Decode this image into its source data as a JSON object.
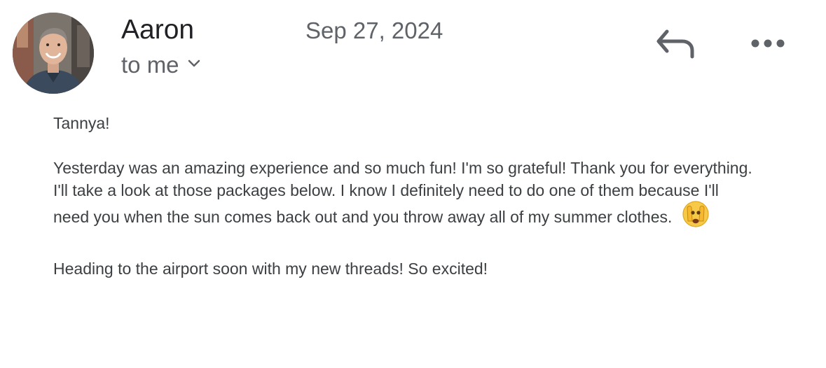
{
  "message": {
    "sender_name": "Aaron",
    "date": "Sep 27, 2024",
    "recipient_label": "to me",
    "greeting": "Tannya!",
    "paragraph1": "Yesterday was an amazing experience and so much fun! I'm so grateful! Thank you for everything. I'll take a look at those packages below. I know I definitely need to do one of them because I'll need you when the sun comes back out and you throw away all of my summer clothes.",
    "paragraph2": "Heading to the airport soon with my new threads! So excited!"
  },
  "icons": {
    "avatar": "avatar-photo",
    "recipient_toggle": "chevron-down-icon",
    "reply": "reply-icon",
    "more": "more-horizontal-icon",
    "emoji": "face-with-hand-over-eyes-emoji"
  },
  "colors": {
    "sender": "#202124",
    "secondary_text": "#5f6368",
    "body_text": "#3c4043",
    "icon": "#5f6368"
  }
}
